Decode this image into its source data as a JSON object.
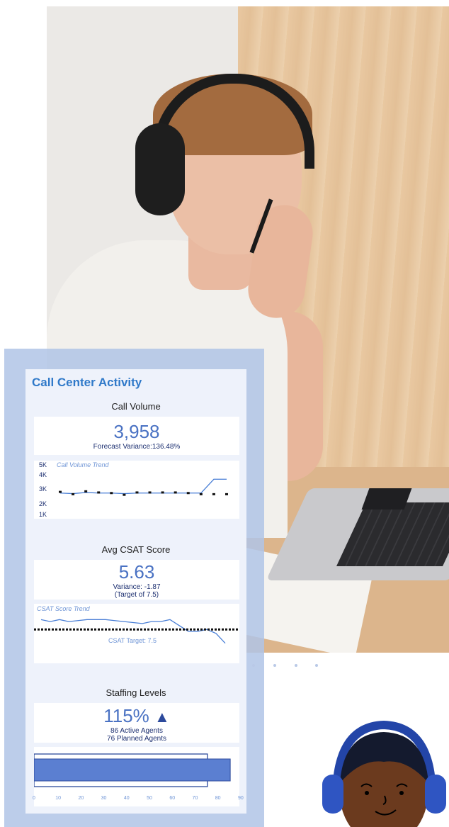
{
  "dashboard": {
    "title": "Call Center Activity",
    "call_volume": {
      "section_title": "Call Volume",
      "value": "3,958",
      "variance": "Forecast Variance:136.48%",
      "trend_label": "Call Volume Trend",
      "y_ticks": [
        "5K",
        "4K",
        "3K",
        "2K",
        "1K"
      ]
    },
    "csat": {
      "section_title": "Avg CSAT Score",
      "value": "5.63",
      "variance": "Variance: -1.87",
      "target_note": "(Target of 7.5)",
      "trend_label": "CSAT Score Trend",
      "target_label": "CSAT Target: 7.5"
    },
    "staffing": {
      "section_title": "Staffing Levels",
      "value": "115%",
      "indicator": "▲",
      "active": "86 Active Agents",
      "planned": "76 Planned Agents",
      "x_ticks": [
        "0",
        "10",
        "20",
        "30",
        "40",
        "50",
        "60",
        "70",
        "80",
        "90"
      ]
    }
  },
  "colors": {
    "accent": "#2f79c9",
    "value_blue": "#4a72c3",
    "dark_navy": "#1c2f70",
    "bar_fill": "#5b7fd1",
    "overlay": "#b0c4e6"
  },
  "chart_data": [
    {
      "type": "line",
      "title": "Call Volume Trend",
      "x": [
        1,
        2,
        3,
        4,
        5,
        6,
        7,
        8,
        9,
        10,
        11,
        12,
        13,
        14
      ],
      "series": [
        {
          "values": [
            2800,
            2750,
            2850,
            2800,
            2800,
            2750,
            2800,
            2800,
            2800,
            2800,
            2800,
            2800,
            4000,
            4000
          ]
        },
        {
          "values": [
            2900,
            2700,
            2950,
            2850,
            2800,
            2650,
            2850,
            2850,
            2850,
            2850,
            2800,
            2700,
            2700,
            2700
          ]
        }
      ],
      "ylim": [
        1000,
        5000
      ],
      "yticks": [
        "5K",
        "4K",
        "3K",
        "2K",
        "1K"
      ]
    },
    {
      "type": "line",
      "title": "CSAT Score Trend",
      "x": [
        1,
        2,
        3,
        4,
        5,
        6,
        7,
        8,
        9,
        10,
        11,
        12,
        13,
        14,
        15,
        16,
        17,
        18,
        19,
        20,
        21
      ],
      "series": [
        {
          "values": [
            8.0,
            7.9,
            8.0,
            7.9,
            7.95,
            8.0,
            8.0,
            8.0,
            7.95,
            7.9,
            7.85,
            7.8,
            7.9,
            7.9,
            8.0,
            7.7,
            7.4,
            7.4,
            7.5,
            7.3,
            6.8
          ]
        }
      ],
      "target": 7.5,
      "target_label": "CSAT Target: 7.5",
      "ylim": [
        5,
        10
      ]
    },
    {
      "type": "bar",
      "title": "Staffing Levels",
      "categories": [
        "Active",
        "Planned"
      ],
      "values": [
        86,
        76
      ],
      "xlim": [
        0,
        90
      ],
      "xticks": [
        "0",
        "10",
        "20",
        "30",
        "40",
        "50",
        "60",
        "70",
        "80",
        "90"
      ]
    }
  ]
}
